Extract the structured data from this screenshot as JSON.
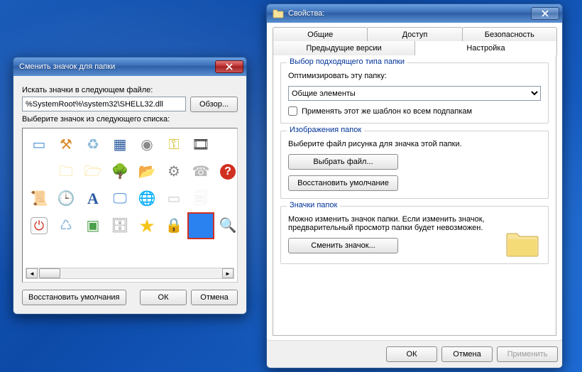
{
  "iconDialog": {
    "title": "Сменить значок для папки",
    "searchLabel": "Искать значки в следующем файле:",
    "path": "%SystemRoot%\\system32\\SHELL32.dll",
    "browse": "Обзор...",
    "pickLabel": "Выберите значок из следующего списка:",
    "restore": "Восстановить умолчания",
    "ok": "ОК",
    "cancel": "Отмена",
    "icons": [
      "screen-icon",
      "drill-icon",
      "recycle-full-icon",
      "appgroup-icon",
      "cd-drive-icon",
      "key-icon",
      "film-icon",
      "",
      "doc-icon",
      "net-folder-icon",
      "net-folder2-icon",
      "tree-icon",
      "folder-open-icon",
      "gear-small-icon",
      "modem-icon",
      "help-icon",
      "cert-icon",
      "clock-disk-icon",
      "font-a-icon",
      "monitor-icon",
      "globe-folder-icon",
      "rect-icon",
      "docs-stack-icon",
      "",
      "power-icon",
      "recycle-empty-icon",
      "chip-icon",
      "server-icon",
      "star-icon",
      "lock-icon",
      "blank-blue-icon",
      "search-icon"
    ],
    "selectedIndex": 30
  },
  "propsDialog": {
    "title": "Свойства:",
    "tabsRow1": [
      "Общие",
      "Доступ",
      "Безопасность"
    ],
    "tabsRow2": [
      "Предыдущие версии",
      "Настройка"
    ],
    "activeTab": "Настройка",
    "group1": {
      "title": "Выбор подходящего типа папки",
      "optLabel": "Оптимизировать эту папку:",
      "comboValue": "Общие элементы",
      "applyChk": "Применять этот же шаблон ко всем подпапкам"
    },
    "group2": {
      "title": "Изображения папок",
      "desc": "Выберите файл рисунка для значка этой папки.",
      "chooseFile": "Выбрать файл...",
      "restoreDefault": "Восстановить умолчание"
    },
    "group3": {
      "title": "Значки папок",
      "desc": "Можно изменить значок папки. Если изменить значок, предварительный просмотр папки будет невозможен.",
      "changeIcon": "Сменить значок..."
    },
    "footer": {
      "ok": "ОК",
      "cancel": "Отмена",
      "apply": "Применить"
    }
  }
}
